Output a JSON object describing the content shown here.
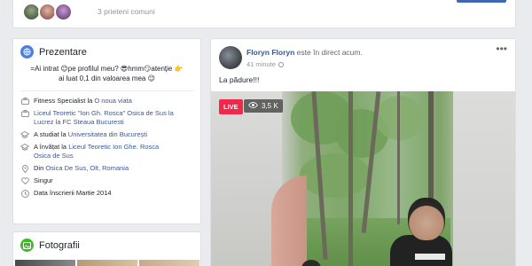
{
  "friends": {
    "count_text": "3 prieteni comuni",
    "avatar_colors": [
      "#2d4a2b",
      "#8a3b3b",
      "#5a2d6a"
    ]
  },
  "intro": {
    "title": "Prezentare",
    "bio_line1": "=Ai intrat 😉pe profilul meu? 😎hmm😏atenție 👉",
    "bio_line2": "ai luat 0,1 din valoarea mea 😉",
    "items": [
      {
        "icon": "briefcase-icon",
        "prefix": "Fitness Specialist la ",
        "link": "O noua viata",
        "suffix": ""
      },
      {
        "icon": "briefcase-icon",
        "prefix": "",
        "link": "Liceul Teoretic \"Ion Gh. Rosca\" Osica de Sus la",
        "suffix": ""
      },
      {
        "icon": "",
        "prefix": "",
        "link": "Lucrez la FC Steaua Bucuresti",
        "suffix": ""
      },
      {
        "icon": "graduation-cap-icon",
        "prefix": "A studiat la ",
        "link": "Universitatea din București",
        "suffix": ""
      },
      {
        "icon": "graduation-cap-icon",
        "prefix": "A învățat la ",
        "link": "Liceul Teoretic Ion Ghe. Rosca",
        "suffix": ""
      },
      {
        "icon": "",
        "prefix": "",
        "link": "Osica de Sus",
        "suffix": ""
      },
      {
        "icon": "location-pin-icon",
        "prefix": "Din ",
        "link": "Osica De Sus, Olt, Romania",
        "suffix": ""
      },
      {
        "icon": "heart-icon",
        "prefix": "Singur",
        "link": "",
        "suffix": ""
      },
      {
        "icon": "clock-icon",
        "prefix": "Data înscrierii Martie 2014",
        "link": "",
        "suffix": ""
      }
    ]
  },
  "photos": {
    "title": "Fotografii"
  },
  "post": {
    "author": "Floryn Floryn",
    "status": " este în direct acum.",
    "time": "41 minute",
    "text": "La pădure!!!",
    "live_label": "LIVE",
    "viewers": "3,5 K"
  },
  "colors": {
    "fb_blue": "#4267b2",
    "link": "#365899",
    "live_red": "#f02849",
    "background": "#e9ebee"
  }
}
